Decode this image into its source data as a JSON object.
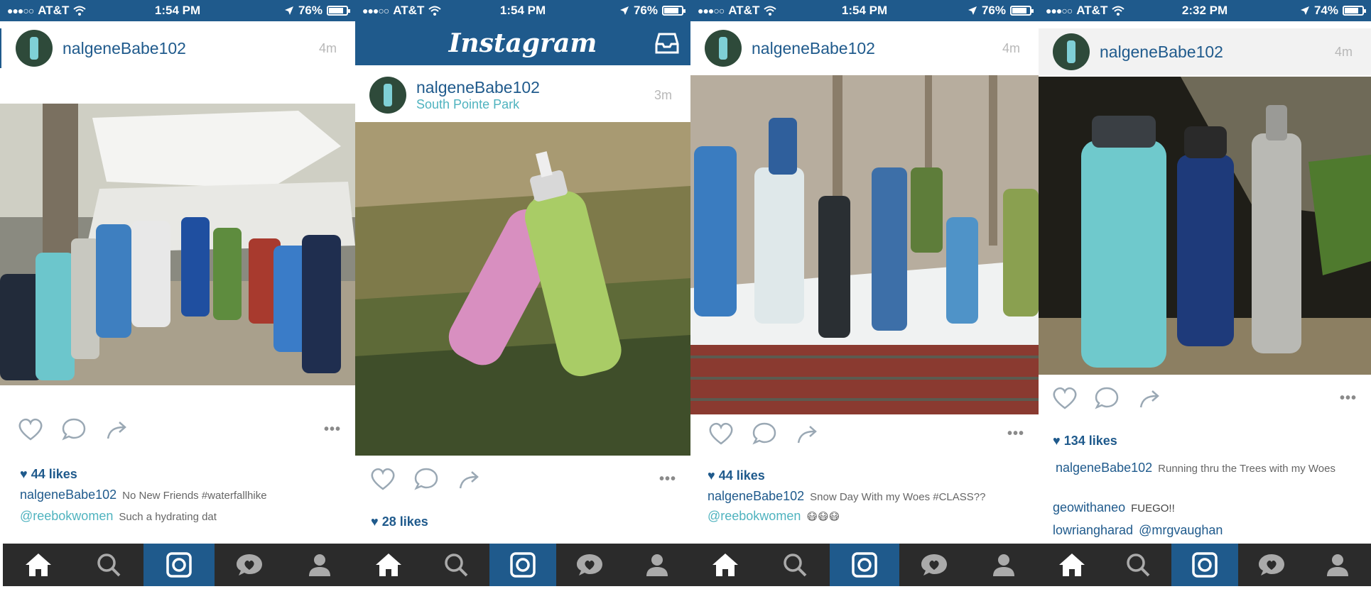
{
  "colors": {
    "accent": "#1f5a8c",
    "tabbar": "#2b2b2b",
    "location": "#4fb3bf"
  },
  "icons": {
    "status": [
      "signal-dots-icon",
      "wifi-icon",
      "location-arrow-icon",
      "battery-icon"
    ],
    "actions": [
      "heart-icon",
      "comment-icon",
      "share-icon",
      "more-icon"
    ],
    "tabs": [
      "home-icon",
      "search-icon",
      "camera-icon",
      "activity-icon",
      "profile-icon"
    ],
    "header": [
      "inbox-icon"
    ]
  },
  "panels": [
    {
      "status": {
        "carrier": "AT&T",
        "time": "1:54 PM",
        "battery": "76%"
      },
      "post": {
        "username": "nalgeneBabe102",
        "time_ago": "4m",
        "likes": "44 likes",
        "caption": {
          "user": "nalgeneBabe102",
          "text": "No New Friends #waterfallhike"
        },
        "comment": {
          "user": "@reebokwomen",
          "text": "Such a hydrating dat"
        }
      }
    },
    {
      "status": {
        "carrier": "AT&T",
        "time": "1:54 PM",
        "battery": "76%"
      },
      "app_title": "Instagram",
      "post": {
        "username": "nalgeneBabe102",
        "location": "South Pointe Park",
        "time_ago": "3m",
        "likes": "28 likes"
      }
    },
    {
      "status": {
        "carrier": "AT&T",
        "time": "1:54 PM",
        "battery": "76%"
      },
      "post": {
        "username": "nalgeneBabe102",
        "time_ago": "4m",
        "likes": "44 likes",
        "caption": {
          "user": "nalgeneBabe102",
          "text": "Snow Day With my Woes #CLASS??"
        },
        "comment": {
          "user": "@reebokwomen",
          "text": "😷😷😷"
        }
      }
    },
    {
      "status": {
        "carrier": "AT&T",
        "time": "2:32 PM",
        "battery": "74%"
      },
      "post": {
        "username": "nalgeneBabe102",
        "time_ago": "4m",
        "likes": "134 likes",
        "caption": {
          "user": "nalgeneBabe102",
          "text": "Running thru the Trees with my Woes"
        },
        "comments": [
          {
            "user": "geowithaneo",
            "text": "FUEGO!!"
          },
          {
            "user": "lowriangharad",
            "text": "@mrgvaughan"
          }
        ]
      }
    }
  ]
}
